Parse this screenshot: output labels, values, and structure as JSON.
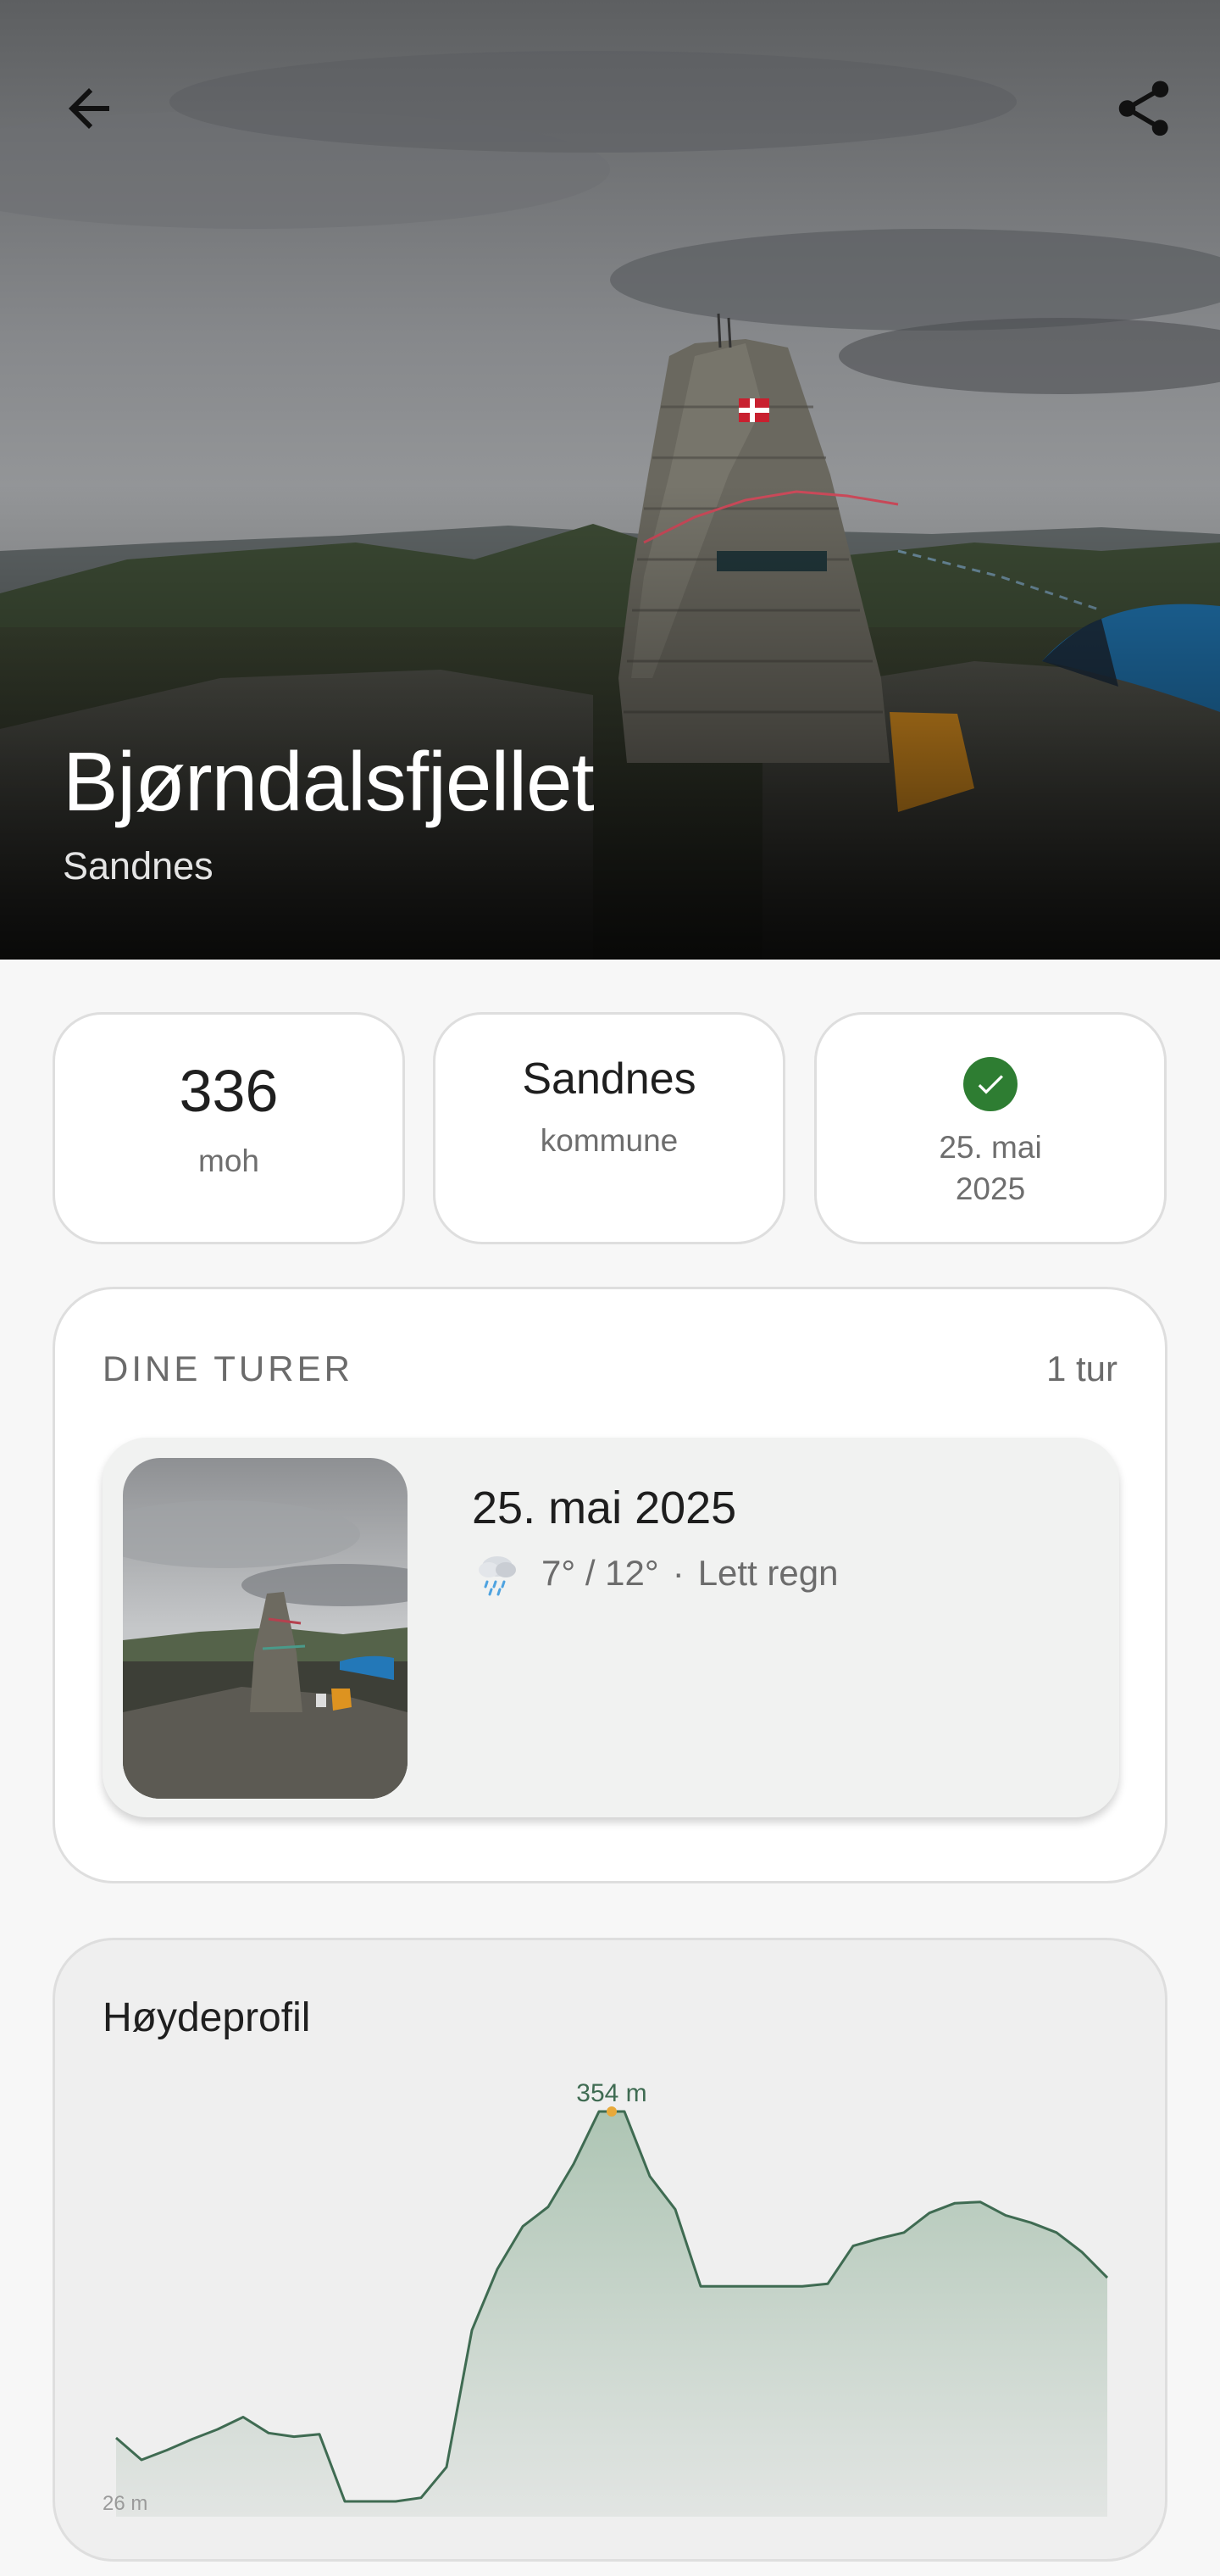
{
  "hero": {
    "title": "Bjørndalsfjellet",
    "subtitle": "Sandnes",
    "back_icon": "arrow-left-icon",
    "share_icon": "share-icon"
  },
  "stats": {
    "elevation_value": "336",
    "elevation_unit": "moh",
    "municipality_value": "Sandnes",
    "municipality_label": "kommune",
    "visited_icon": "check-circle-icon",
    "visited_date_line1": "25. mai",
    "visited_date_line2": "2025"
  },
  "trips": {
    "heading": "DINE TURER",
    "count": "1 tur",
    "items": [
      {
        "date": "25. mai 2025",
        "weather_icon": "rain-cloud-icon",
        "temperature": "7° / 12°",
        "separator": "·",
        "condition": "Lett regn"
      }
    ]
  },
  "elevation_profile": {
    "title": "Høydeprofil",
    "max_label": "354 m",
    "min_label": "26 m",
    "colors": {
      "line": "#3f6b52",
      "fill_top": "#b8cbbd",
      "marker": "#e8a93a"
    }
  },
  "chart_data": {
    "type": "area",
    "title": "Høydeprofil",
    "xlabel": "",
    "ylabel": "",
    "ylim": [
      26,
      354
    ],
    "annotations": [
      "354 m",
      "26 m"
    ],
    "values": [
      87,
      69,
      77,
      86,
      94,
      104,
      91,
      88,
      90,
      35,
      35,
      35,
      38,
      63,
      175,
      225,
      260,
      276,
      311,
      354,
      354,
      301,
      274,
      211,
      211,
      211,
      211,
      211,
      213,
      244,
      250,
      255,
      271,
      279,
      280,
      269,
      263,
      255,
      239,
      218
    ]
  }
}
